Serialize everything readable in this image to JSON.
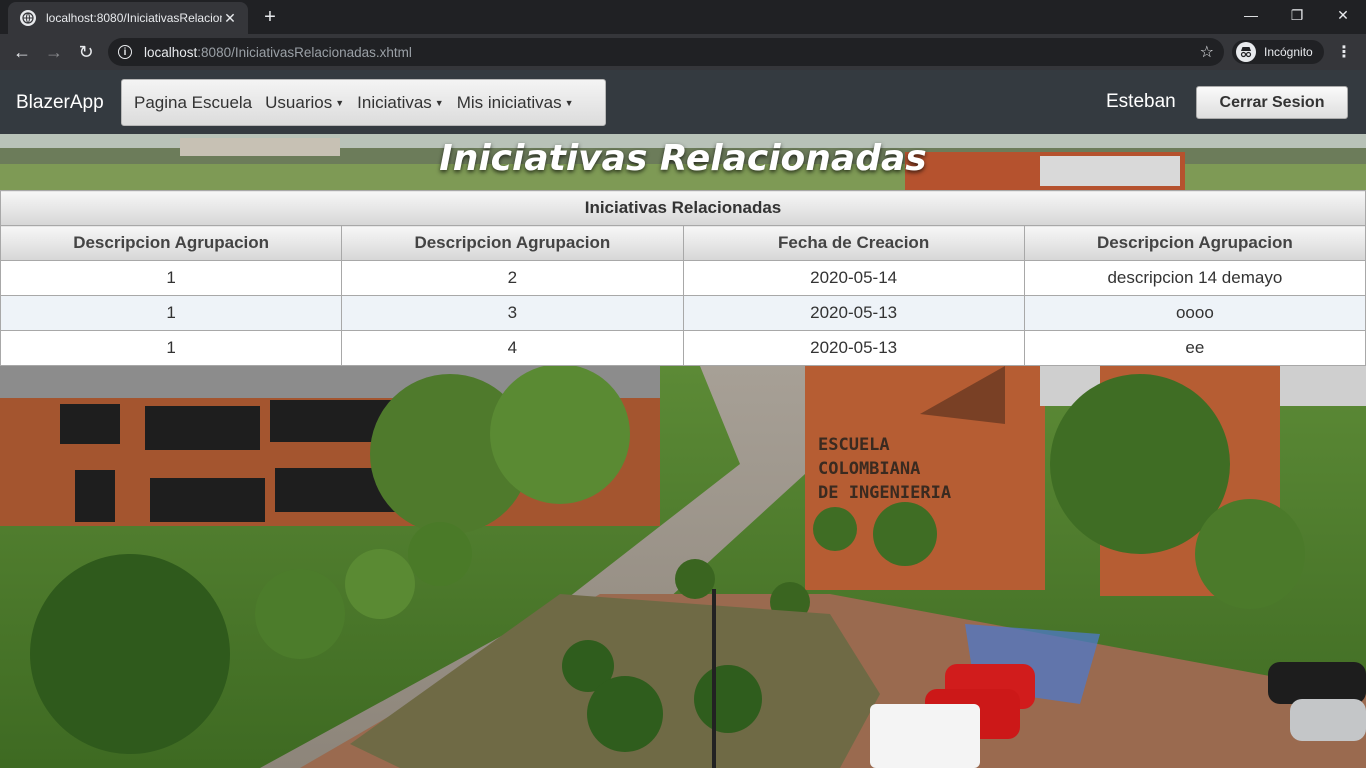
{
  "browser": {
    "tab_title": "localhost:8080/IniciativasRelacionadas.xhtml",
    "url_host": "localhost",
    "url_path": ":8080/IniciativasRelacionadas.xhtml",
    "profile_label": "Incógnito"
  },
  "navbar": {
    "brand": "BlazerApp",
    "menu": [
      {
        "label": "Pagina Escuela",
        "dropdown": false
      },
      {
        "label": "Usuarios",
        "dropdown": true
      },
      {
        "label": "Iniciativas",
        "dropdown": true
      },
      {
        "label": "Mis iniciativas",
        "dropdown": true
      }
    ],
    "user_name": "Esteban",
    "logout_label": "Cerrar Sesion"
  },
  "page": {
    "heading": "Iniciativas Relacionadas"
  },
  "table": {
    "caption": "Iniciativas Relacionadas",
    "columns": [
      "Descripcion Agrupacion",
      "Descripcion Agrupacion",
      "Fecha de Creacion",
      "Descripcion Agrupacion"
    ],
    "rows": [
      [
        "1",
        "2",
        "2020-05-14",
        "descripcion 14 demayo"
      ],
      [
        "1",
        "3",
        "2020-05-13",
        "oooo"
      ],
      [
        "1",
        "4",
        "2020-05-13",
        "ee"
      ]
    ]
  },
  "background": {
    "sign_text": [
      "ESCUELA",
      "COLOMBIANA",
      "DE INGENIERIA"
    ]
  }
}
